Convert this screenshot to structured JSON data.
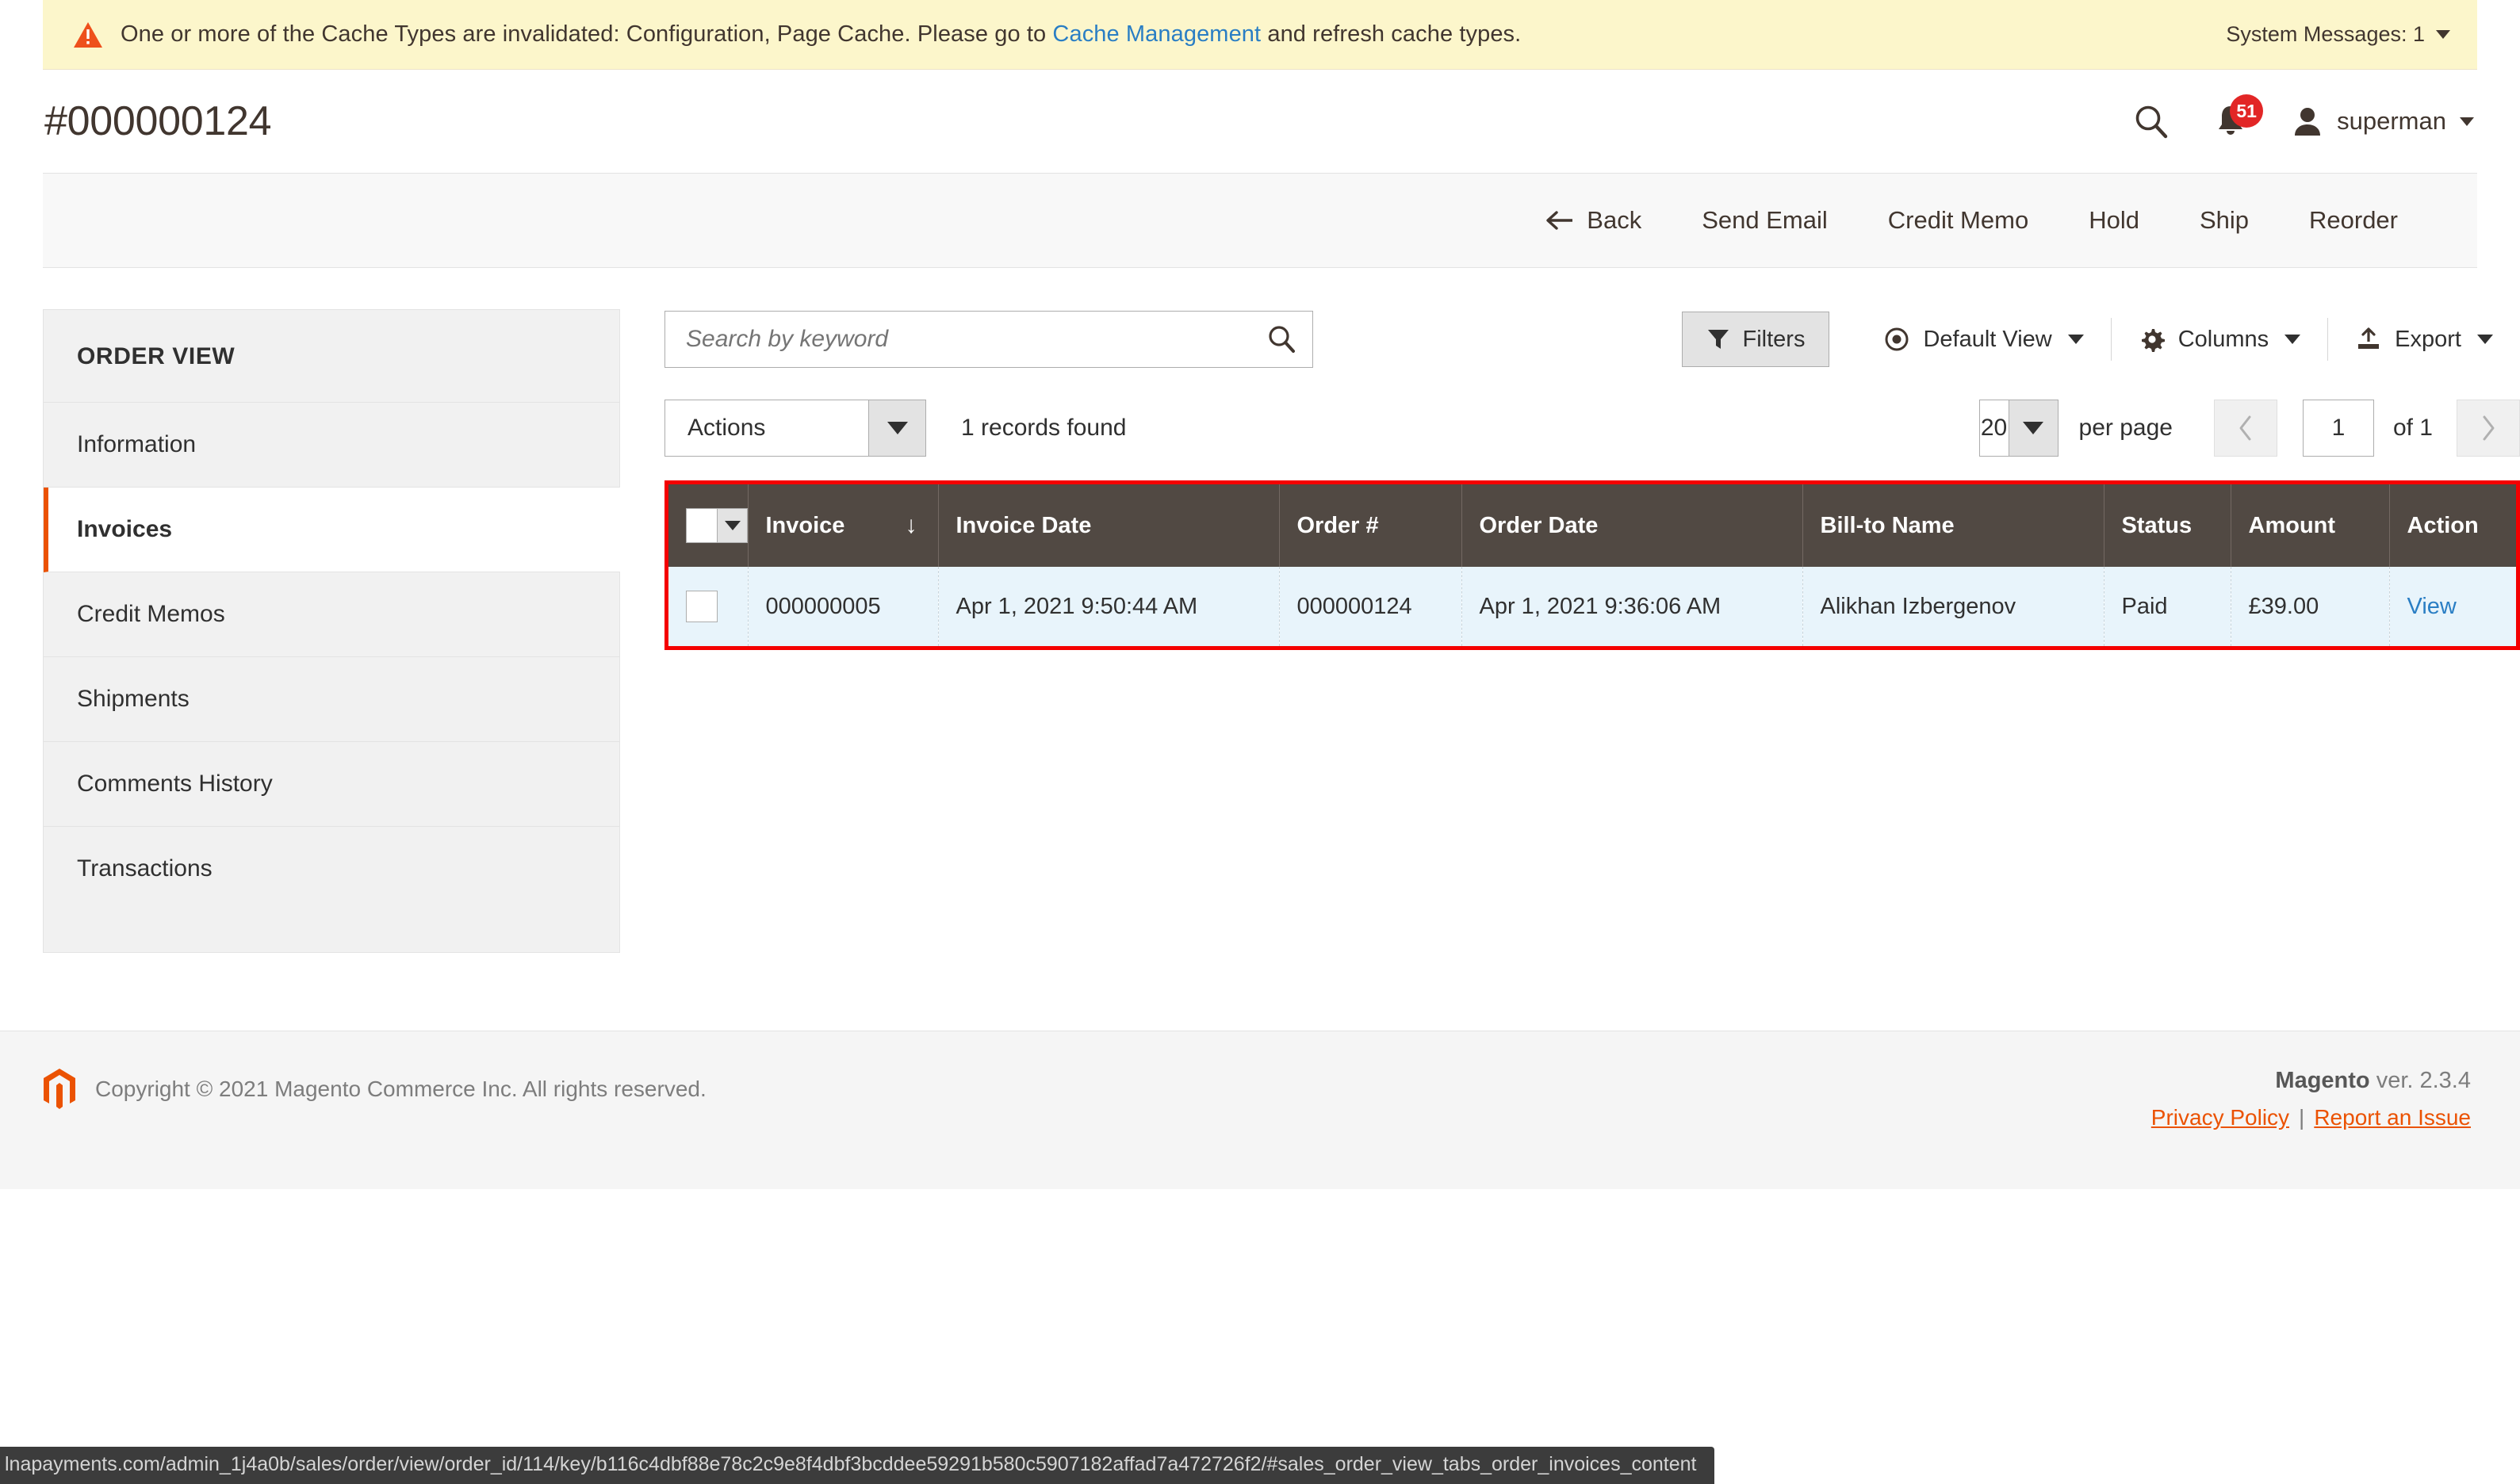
{
  "system_message": {
    "icon": "warning-triangle-icon",
    "text_before_link": "One or more of the Cache Types are invalidated: Configuration, Page Cache. Please go to ",
    "link_label": "Cache Management",
    "text_after_link": " and refresh cache types.",
    "right_label": "System Messages: 1",
    "background": "#fcf6cb",
    "link_color": "#2a7ec4"
  },
  "header": {
    "title": "#000000124",
    "search_icon": "search-icon",
    "bell_icon": "bell-icon",
    "notification_count": "51",
    "notification_color": "#e22626",
    "avatar_icon": "user-avatar-icon",
    "user_name": "superman"
  },
  "actions": {
    "back": "Back",
    "send_email": "Send Email",
    "credit_memo": "Credit Memo",
    "hold": "Hold",
    "ship": "Ship",
    "reorder": "Reorder"
  },
  "sidebar": {
    "title": "ORDER VIEW",
    "active_color": "#eb5202",
    "items": [
      {
        "label": "Information",
        "active": false
      },
      {
        "label": "Invoices",
        "active": true
      },
      {
        "label": "Credit Memos",
        "active": false
      },
      {
        "label": "Shipments",
        "active": false
      },
      {
        "label": "Comments History",
        "active": false
      },
      {
        "label": "Transactions",
        "active": false
      }
    ]
  },
  "grid_toolbar": {
    "search_placeholder": "Search by keyword",
    "search_value": "",
    "search_icon": "search-icon",
    "filters_label": "Filters",
    "filters_icon": "funnel-icon",
    "default_view_label": "Default View",
    "default_view_icon": "eye-icon",
    "columns_label": "Columns",
    "columns_icon": "gear-icon",
    "export_label": "Export",
    "export_icon": "upload-icon",
    "actions_label": "Actions",
    "records_found": "1 records found",
    "per_page_value": "20",
    "per_page_label": "per page",
    "page_value": "1",
    "page_of": "of 1"
  },
  "table": {
    "highlight_color": "#f40000",
    "header_background": "#514943",
    "row_background": "#e8f4fb",
    "sort_indicator": "↓",
    "sorted_column": "Invoice",
    "columns": [
      "Invoice",
      "Invoice Date",
      "Order #",
      "Order Date",
      "Bill-to Name",
      "Status",
      "Amount",
      "Action"
    ],
    "rows": [
      {
        "invoice": "000000005",
        "invoice_date": "Apr 1, 2021 9:50:44 AM",
        "order_number": "000000124",
        "order_date": "Apr 1, 2021 9:36:06 AM",
        "bill_to_name": "Alikhan Izbergenov",
        "status": "Paid",
        "amount": "£39.00",
        "action": "View"
      }
    ]
  },
  "footer": {
    "logo_icon": "magento-logo-icon",
    "copyright": "Copyright © 2021 Magento Commerce Inc. All rights reserved.",
    "brand": "Magento",
    "version": " ver. 2.3.4",
    "privacy_policy": "Privacy Policy",
    "link_separator": "|",
    "report_issue": "Report an Issue",
    "link_color": "#eb5202"
  },
  "status_bar": {
    "url": "lnapayments.com/admin_1j4a0b/sales/order/view/order_id/114/key/b116c4dbf88e78c2c9e8f4dbf3bcddee59291b580c5907182affad7a472726f2/#sales_order_view_tabs_order_invoices_content"
  }
}
